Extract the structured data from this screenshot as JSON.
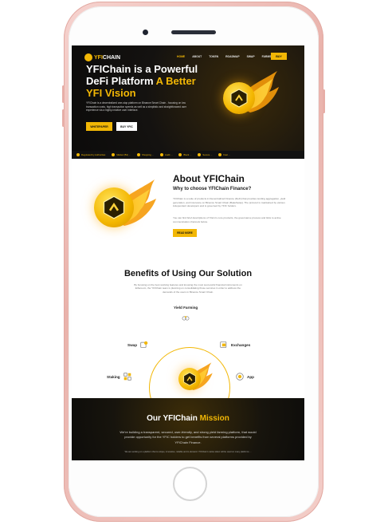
{
  "nav": {
    "logo_prefix": "YFI",
    "logo_suffix": "CHAIN",
    "links": [
      "HOME",
      "ABOUT",
      "TOKEN",
      "ROADMAP",
      "SWAP",
      "FARMS"
    ],
    "buy_label": "BUY"
  },
  "hero": {
    "title_line1": "YFIChain is a Powerful",
    "title_line2_white": "DeFi Platform",
    "title_line2_yellow": "A Better",
    "title_line3": "YFI Vision",
    "description": "YFIChain is a decentralized one-stop platform on Binance Smart Chain - focusing on low transaction costs, high transaction speeds as well as a simplistic and straightforward user experience via a highly-intuitive user interface.",
    "whitepaper_label": "WHITEPAPER",
    "buy_label": "BUY YFIC"
  },
  "ticker": {
    "items": [
      "Regulated by Authorities",
      "Market (B1) ...",
      "Shopping ...",
      "Audit ...",
      "Block ...",
      "Secure ...",
      "Fast ..."
    ]
  },
  "about": {
    "title": "About YFIChain",
    "subtitle": "Why to choose YFIChain Finance?",
    "para1": "YFIChain is a suite of products in Decentralized Finance (DeFi) that provides lending aggregation, yield generation, and insurance on Binance Smart Chain (BakeSwap). The protocol is maintained by various independent developers and is governed by YFIC holders.",
    "para2": "You can find brief descriptions of Yfarm's core products, the governance process and links to active communication channels below.",
    "button_label": "READ MORE"
  },
  "benefits": {
    "title": "Benefits of Using Our Solution",
    "description": "By focusing on the best working features and knowing the most successful financial instruments on Ethereum, the YFIChain team is planning on consolidating those services in order to address the demands of the users in Binance Smart Chain.",
    "features": {
      "yield": "Yield Farming",
      "swap": "Swap",
      "exchanges": "Exchanges",
      "staking": "Staking",
      "app": "App"
    }
  },
  "mission": {
    "title_white": "Our YFIChain",
    "title_yellow": "Mission",
    "para": "We're building a transparent, secured, user-friendly, and strong yield farming platform, that would provide opportunity for the YFIC holders to get benefits from several platforms provided by YFIChain Finance.",
    "small": "We are working on a platform that is unique, innovative, reliable and in-demand. YFIChain's native token will be used on many platforms ..."
  },
  "colors": {
    "accent": "#f2b705",
    "dark_bg": "#0c0b0a",
    "phone_frame": "#e9b2ab"
  },
  "icons": [
    "yficoin-icon",
    "flame-icon",
    "swap-icon",
    "exchange-icon",
    "staking-icon",
    "app-icon",
    "yield-farming-icon"
  ]
}
